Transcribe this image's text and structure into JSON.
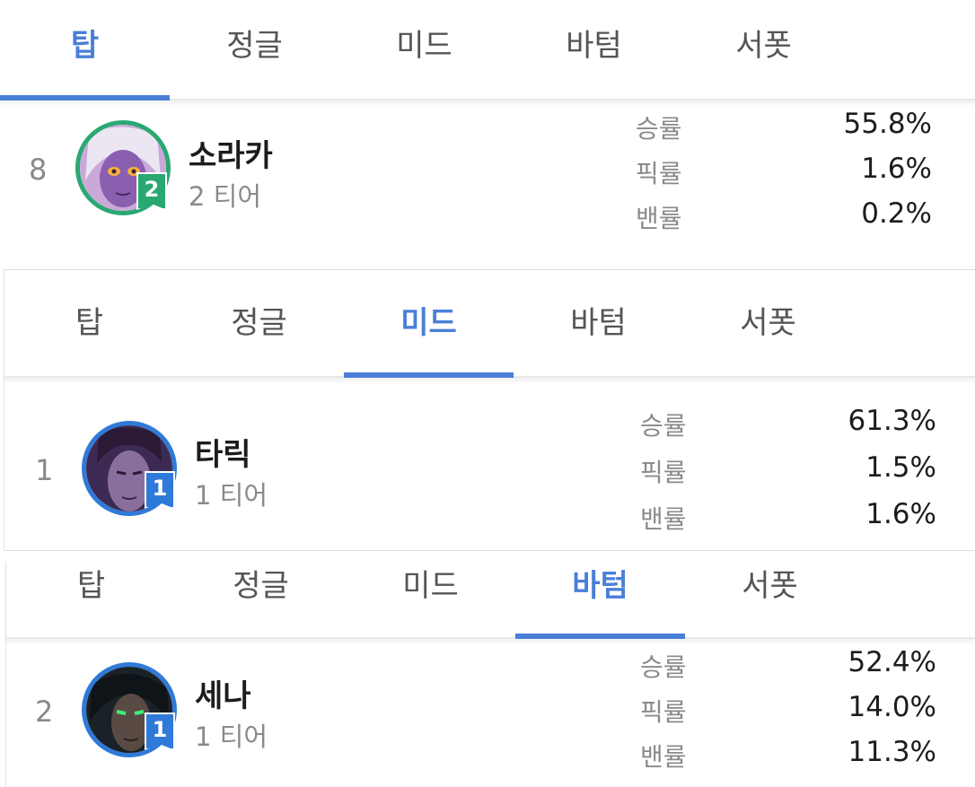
{
  "tabs": [
    "탑",
    "정글",
    "미드",
    "바텀",
    "서폿"
  ],
  "stat_labels": {
    "winrate": "승률",
    "pickrate": "픽률",
    "banrate": "밴률"
  },
  "colors": {
    "accent": "#4a7fd8",
    "tier1": "#2f7ad8",
    "tier2": "#2aa872"
  },
  "panels": [
    {
      "active_tab": "탑",
      "champion": {
        "rank": "8",
        "name": "소라카",
        "tier_badge": "2",
        "tier_text": "2 티어",
        "winrate": "55.8%",
        "pickrate": "1.6%",
        "banrate": "0.2%"
      }
    },
    {
      "active_tab": "미드",
      "champion": {
        "rank": "1",
        "name": "타릭",
        "tier_badge": "1",
        "tier_text": "1 티어",
        "winrate": "61.3%",
        "pickrate": "1.5%",
        "banrate": "1.6%"
      }
    },
    {
      "active_tab": "바텀",
      "champion": {
        "rank": "2",
        "name": "세나",
        "tier_badge": "1",
        "tier_text": "1 티어",
        "winrate": "52.4%",
        "pickrate": "14.0%",
        "banrate": "11.3%"
      }
    }
  ]
}
